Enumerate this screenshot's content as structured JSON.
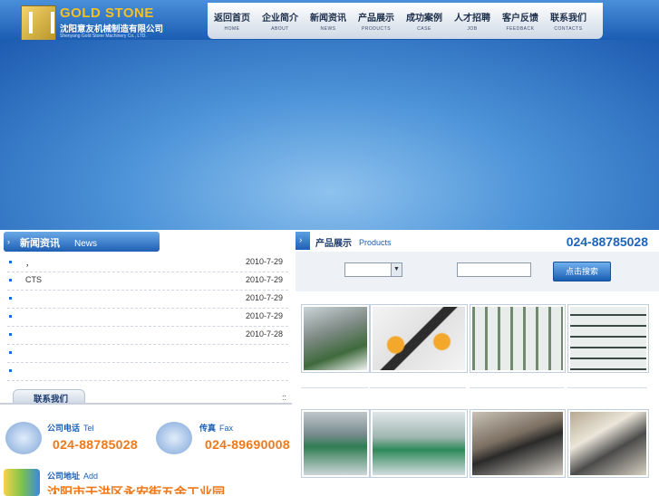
{
  "brand": {
    "title": "GOLD STONE",
    "cn_name": "沈阳意友机械制造有限公司",
    "en_name": "Shenyang Gold Stone Machinery Co., LTD."
  },
  "nav": [
    {
      "cn": "返回首页",
      "en": "HOME"
    },
    {
      "cn": "企业简介",
      "en": "ABOUT"
    },
    {
      "cn": "新闻资讯",
      "en": "NEWS"
    },
    {
      "cn": "产品展示",
      "en": "PRODUCTS"
    },
    {
      "cn": "成功案例",
      "en": "CASE"
    },
    {
      "cn": "人才招聘",
      "en": "JOB"
    },
    {
      "cn": "客户反馈",
      "en": "FEEDBACK"
    },
    {
      "cn": "联系我们",
      "en": "CONTACTS"
    }
  ],
  "news": {
    "title_cn": "新闻资讯",
    "title_en": "News",
    "rows": [
      {
        "title": "，",
        "date": "2010-7-29"
      },
      {
        "title": "CTS",
        "date": "2010-7-29"
      },
      {
        "title": "",
        "date": "2010-7-29"
      },
      {
        "title": "",
        "date": "2010-7-29"
      },
      {
        "title": "",
        "date": "2010-7-28"
      },
      {
        "title": "",
        "date": ""
      },
      {
        "title": "",
        "date": ""
      }
    ]
  },
  "contact": {
    "title": "联系我们",
    "dots": "::",
    "phone_label_cn": "公司电话",
    "phone_label_en": "Tel",
    "phone": "024-88785028",
    "fax_label_cn": "传真",
    "fax_label_en": "Fax",
    "fax": "024-89690008",
    "addr_label_cn": "公司地址",
    "addr_label_en": "Add",
    "addr": "沈阳市于洪区永安街五金工业园"
  },
  "products": {
    "title_cn": "产品展示",
    "title_en": "Products",
    "phone": "024-88785028",
    "search_button": "点击搜索",
    "select_value": "",
    "keyword_value": ""
  },
  "product_tiles_row1": [
    {
      "icon": "conveyor-line-photo"
    },
    {
      "icon": "roller-module-photo"
    },
    {
      "icon": "pipe-rack-photo"
    },
    {
      "icon": "pipe-shelf-photo"
    }
  ],
  "product_tiles_row2": [
    {
      "icon": "assembly-line-photo"
    },
    {
      "icon": "workshop-line-photo"
    },
    {
      "icon": "belt-conveyor-photo"
    },
    {
      "icon": "conveyor-machine-photo"
    }
  ]
}
